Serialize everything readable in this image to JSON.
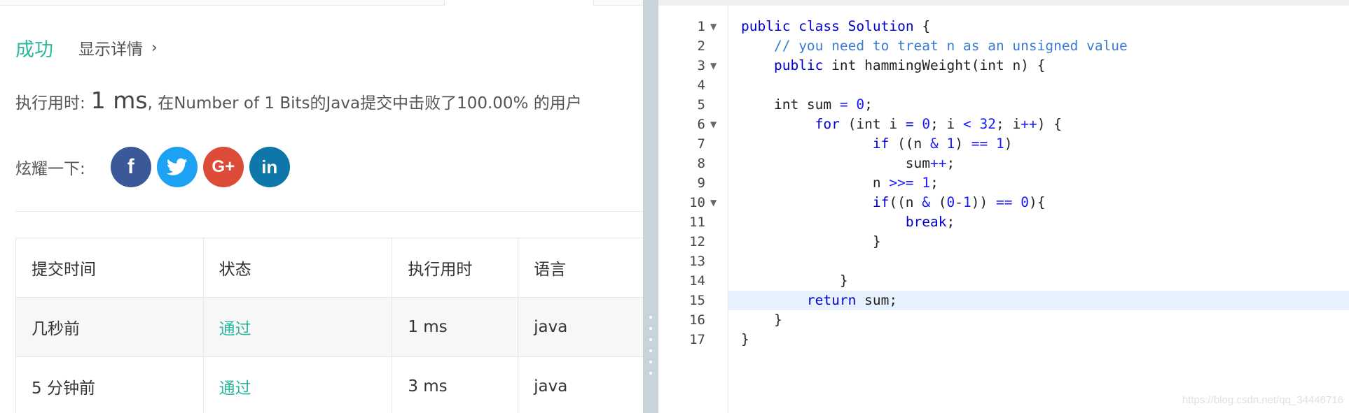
{
  "result": {
    "status": "成功",
    "details_label": "显示详情",
    "chevron": "›"
  },
  "runtime": {
    "label": "执行用时:",
    "value": "1 ms",
    "description": ", 在Number of 1 Bits的Java提交中击败了100.00% 的用户"
  },
  "share": {
    "label": "炫耀一下:",
    "icons": [
      {
        "name": "facebook-icon",
        "glyph": "f"
      },
      {
        "name": "twitter-icon",
        "glyph": ""
      },
      {
        "name": "google-plus-icon",
        "glyph": "G+"
      },
      {
        "name": "linkedin-icon",
        "glyph": "in"
      }
    ]
  },
  "submissions": {
    "headers": [
      "提交时间",
      "状态",
      "执行用时",
      "语言"
    ],
    "rows": [
      {
        "time": "几秒前",
        "status": "通过",
        "runtime": "1 ms",
        "language": "java"
      },
      {
        "time": "5 分钟前",
        "status": "通过",
        "runtime": "3 ms",
        "language": "java"
      }
    ]
  },
  "editor": {
    "active_line": 15,
    "fold_lines": [
      1,
      3,
      6,
      10
    ],
    "lines": [
      "public class Solution {",
      "    // you need to treat n as an unsigned value",
      "    public int hammingWeight(int n) {",
      "",
      "    int sum = 0;",
      "         for (int i = 0; i < 32; i++) {",
      "                if ((n & 1) == 1)",
      "                    sum++;",
      "                n >>= 1;",
      "                if((n & (0-1)) == 0){",
      "                    break;",
      "                }",
      "",
      "            }",
      "        return sum;",
      "    }",
      "}"
    ]
  },
  "watermark": "https://blog.csdn.net/qq_34446716",
  "colors": {
    "success": "#2db7a0",
    "facebook": "#3b5998",
    "twitter": "#1da1f2",
    "google_plus": "#dd4b39",
    "linkedin": "#0e76a8",
    "keyword": "#0000cc",
    "comment": "#3a7bd5",
    "active_line_bg": "#e8f2ff"
  }
}
